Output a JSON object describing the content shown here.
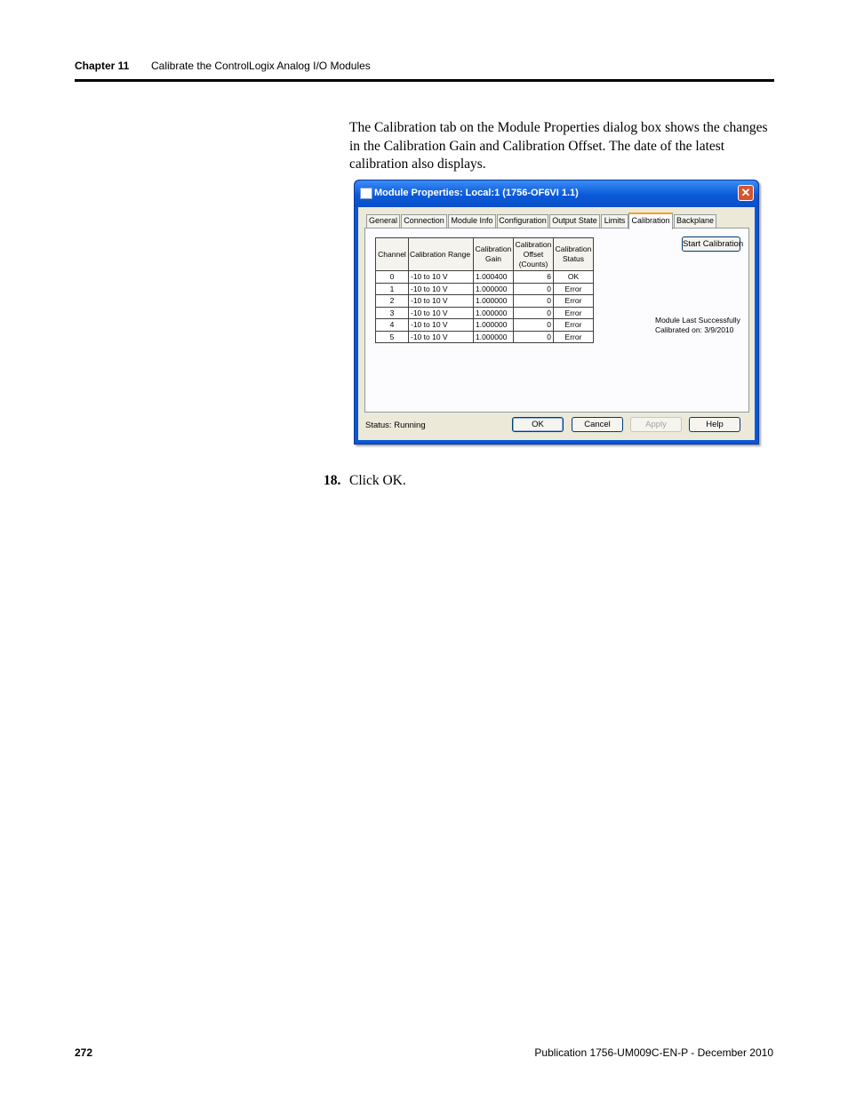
{
  "header": {
    "chapter": "Chapter 11",
    "title": "Calibrate the ControlLogix Analog I/O Modules"
  },
  "body": {
    "paragraph": "The Calibration tab on the Module Properties dialog box shows the changes in the Calibration Gain and Calibration Offset. The date of the latest calibration also displays.",
    "step_number": "18.",
    "step_text": "Click OK."
  },
  "dialog": {
    "title": "Module Properties: Local:1 (1756-OF6VI 1.1)",
    "close": "✕",
    "tabs": [
      "General",
      "Connection",
      "Module Info",
      "Configuration",
      "Output State",
      "Limits",
      "Calibration",
      "Backplane"
    ],
    "active_tab": "Calibration",
    "table": {
      "headers": [
        "Channel",
        "Calibration Range",
        "Calibration Gain",
        "Calibration Offset (Counts)",
        "Calibration Status"
      ],
      "rows": [
        [
          "0",
          "-10 to 10 V",
          "1.000400",
          "6",
          "OK"
        ],
        [
          "1",
          "-10 to 10 V",
          "1.000000",
          "0",
          "Error"
        ],
        [
          "2",
          "-10 to 10 V",
          "1.000000",
          "0",
          "Error"
        ],
        [
          "3",
          "-10 to 10 V",
          "1.000000",
          "0",
          "Error"
        ],
        [
          "4",
          "-10 to 10 V",
          "1.000000",
          "0",
          "Error"
        ],
        [
          "5",
          "-10 to 10 V",
          "1.000000",
          "0",
          "Error"
        ]
      ]
    },
    "start_calibration": "Start Calibration",
    "last_calibrated_line1": "Module Last Successfully",
    "last_calibrated_line2": "Calibrated on:  3/9/2010",
    "status": "Status:  Running",
    "buttons": {
      "ok": "OK",
      "cancel": "Cancel",
      "apply": "Apply",
      "help": "Help"
    }
  },
  "footer": {
    "page_number": "272",
    "publication": "Publication 1756-UM009C-EN-P - December 2010"
  }
}
